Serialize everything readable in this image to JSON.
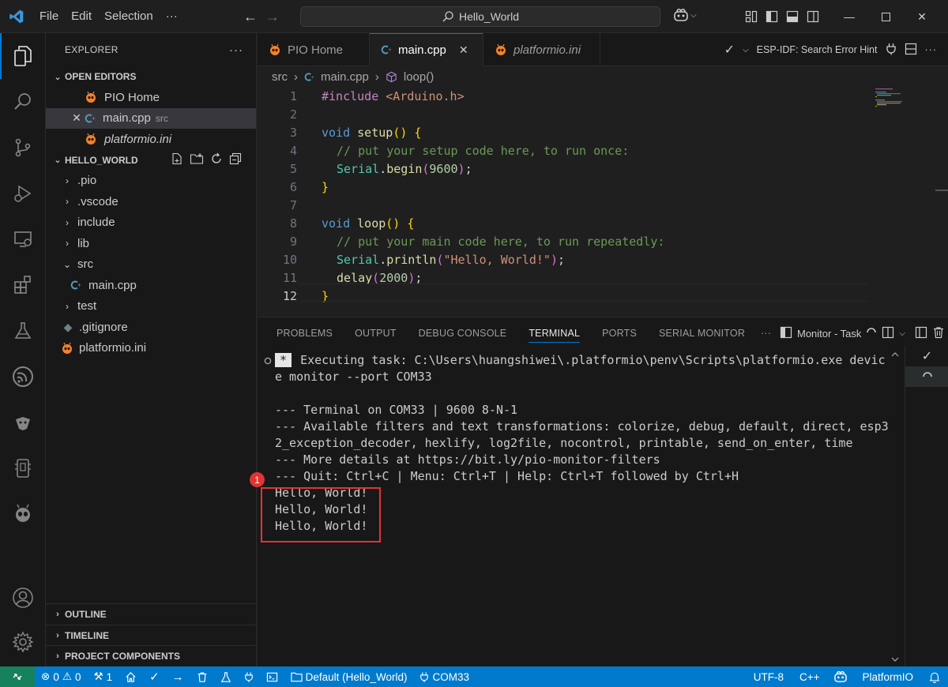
{
  "titlebar": {
    "menu": [
      "File",
      "Edit",
      "Selection",
      "···"
    ],
    "search_text": "Hello_World"
  },
  "sidebar": {
    "header": "EXPLORER",
    "open_editors": {
      "title": "OPEN EDITORS",
      "items": [
        {
          "name": "PIO Home",
          "desc": ""
        },
        {
          "name": "main.cpp",
          "desc": "src"
        },
        {
          "name": "platformio.ini",
          "desc": ""
        }
      ]
    },
    "project": {
      "title": "HELLO_WORLD",
      "tree": [
        {
          "name": ".pio"
        },
        {
          "name": ".vscode"
        },
        {
          "name": "include"
        },
        {
          "name": "lib"
        },
        {
          "name": "src"
        },
        {
          "name": "main.cpp"
        },
        {
          "name": "test"
        },
        {
          "name": ".gitignore"
        },
        {
          "name": "platformio.ini"
        }
      ]
    },
    "bottom_sections": [
      "OUTLINE",
      "TIMELINE",
      "PROJECT COMPONENTS"
    ]
  },
  "tabs": [
    {
      "label": "PIO Home"
    },
    {
      "label": "main.cpp"
    },
    {
      "label": "platformio.ini"
    }
  ],
  "tab_action_text": "ESP-IDF: Search Error Hint",
  "breadcrumb": [
    "src",
    "main.cpp",
    "loop()"
  ],
  "editor": {
    "line_numbers": [
      "1",
      "2",
      "3",
      "4",
      "5",
      "6",
      "7",
      "8",
      "9",
      "10",
      "11",
      "12"
    ],
    "line1": {
      "directive": "#include",
      "header": "<Arduino.h>"
    },
    "line3": {
      "type": "void",
      "fn": "setup",
      "open": "() {"
    },
    "line4": "// put your setup code here, to run once:",
    "line5": {
      "obj": "Serial",
      "dot": ".",
      "method": "begin",
      "arg": "9600",
      "end": ");"
    },
    "line6": "}",
    "line8": {
      "type": "void",
      "fn": "loop",
      "open": "() {"
    },
    "line9": "// put your main code here, to run repeatedly:",
    "line10": {
      "obj": "Serial",
      "dot": ".",
      "method": "println",
      "arg": "\"Hello, World!\"",
      "end": ");"
    },
    "line11": {
      "fn": "delay",
      "arg": "2000",
      "end": ");"
    },
    "line12": "}"
  },
  "panel": {
    "tabs": [
      "PROBLEMS",
      "OUTPUT",
      "DEBUG CONSOLE",
      "TERMINAL",
      "PORTS",
      "SERIAL MONITOR"
    ],
    "task_label": "Monitor - Task",
    "terminal": {
      "star": "*",
      "line1": "Executing task: C:\\Users\\huangshiwei\\.platformio\\penv\\Scripts\\platformio.exe devic",
      "line2": "e monitor --port COM33",
      "line3": "",
      "line4": "--- Terminal on COM33 | 9600 8-N-1",
      "line5": "--- Available filters and text transformations: colorize, debug, default, direct, esp3",
      "line6": "2_exception_decoder, hexlify, log2file, nocontrol, printable, send_on_enter, time",
      "line7": "--- More details at https://bit.ly/pio-monitor-filters",
      "line8": "--- Quit: Ctrl+C | Menu: Ctrl+T | Help: Ctrl+T followed by Ctrl+H",
      "output": [
        "Hello, World!",
        "Hello, World!",
        "Hello, World!"
      ]
    },
    "annotation_badge": "1"
  },
  "statusbar": {
    "errors": "0",
    "warnings": "0",
    "tools": "1",
    "env": "Default (Hello_World)",
    "port": "COM33",
    "encoding": "UTF-8",
    "language": "C++",
    "platform": "PlatformIO"
  },
  "colors": {
    "accent": "#0078d4",
    "statusbar": "#007acc",
    "annotation": "#e03434"
  }
}
